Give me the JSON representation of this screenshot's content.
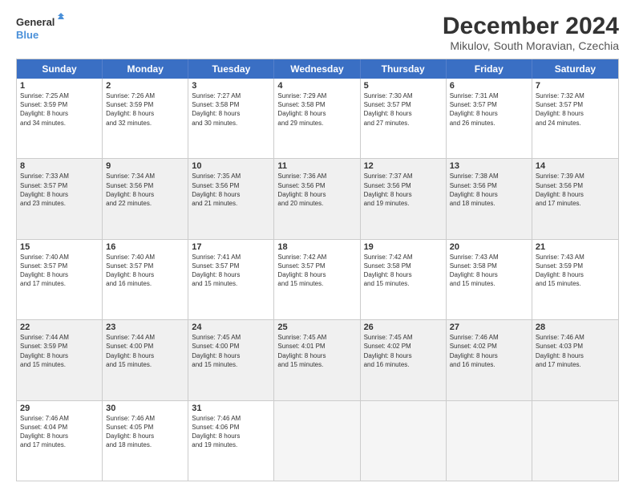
{
  "logo": {
    "line1": "General",
    "line2": "Blue"
  },
  "title": "December 2024",
  "subtitle": "Mikulov, South Moravian, Czechia",
  "days": [
    "Sunday",
    "Monday",
    "Tuesday",
    "Wednesday",
    "Thursday",
    "Friday",
    "Saturday"
  ],
  "rows": [
    [
      {
        "day": "1",
        "lines": [
          "Sunrise: 7:25 AM",
          "Sunset: 3:59 PM",
          "Daylight: 8 hours",
          "and 34 minutes."
        ],
        "shade": false
      },
      {
        "day": "2",
        "lines": [
          "Sunrise: 7:26 AM",
          "Sunset: 3:59 PM",
          "Daylight: 8 hours",
          "and 32 minutes."
        ],
        "shade": false
      },
      {
        "day": "3",
        "lines": [
          "Sunrise: 7:27 AM",
          "Sunset: 3:58 PM",
          "Daylight: 8 hours",
          "and 30 minutes."
        ],
        "shade": false
      },
      {
        "day": "4",
        "lines": [
          "Sunrise: 7:29 AM",
          "Sunset: 3:58 PM",
          "Daylight: 8 hours",
          "and 29 minutes."
        ],
        "shade": false
      },
      {
        "day": "5",
        "lines": [
          "Sunrise: 7:30 AM",
          "Sunset: 3:57 PM",
          "Daylight: 8 hours",
          "and 27 minutes."
        ],
        "shade": false
      },
      {
        "day": "6",
        "lines": [
          "Sunrise: 7:31 AM",
          "Sunset: 3:57 PM",
          "Daylight: 8 hours",
          "and 26 minutes."
        ],
        "shade": false
      },
      {
        "day": "7",
        "lines": [
          "Sunrise: 7:32 AM",
          "Sunset: 3:57 PM",
          "Daylight: 8 hours",
          "and 24 minutes."
        ],
        "shade": false
      }
    ],
    [
      {
        "day": "8",
        "lines": [
          "Sunrise: 7:33 AM",
          "Sunset: 3:57 PM",
          "Daylight: 8 hours",
          "and 23 minutes."
        ],
        "shade": true
      },
      {
        "day": "9",
        "lines": [
          "Sunrise: 7:34 AM",
          "Sunset: 3:56 PM",
          "Daylight: 8 hours",
          "and 22 minutes."
        ],
        "shade": true
      },
      {
        "day": "10",
        "lines": [
          "Sunrise: 7:35 AM",
          "Sunset: 3:56 PM",
          "Daylight: 8 hours",
          "and 21 minutes."
        ],
        "shade": true
      },
      {
        "day": "11",
        "lines": [
          "Sunrise: 7:36 AM",
          "Sunset: 3:56 PM",
          "Daylight: 8 hours",
          "and 20 minutes."
        ],
        "shade": true
      },
      {
        "day": "12",
        "lines": [
          "Sunrise: 7:37 AM",
          "Sunset: 3:56 PM",
          "Daylight: 8 hours",
          "and 19 minutes."
        ],
        "shade": true
      },
      {
        "day": "13",
        "lines": [
          "Sunrise: 7:38 AM",
          "Sunset: 3:56 PM",
          "Daylight: 8 hours",
          "and 18 minutes."
        ],
        "shade": true
      },
      {
        "day": "14",
        "lines": [
          "Sunrise: 7:39 AM",
          "Sunset: 3:56 PM",
          "Daylight: 8 hours",
          "and 17 minutes."
        ],
        "shade": true
      }
    ],
    [
      {
        "day": "15",
        "lines": [
          "Sunrise: 7:40 AM",
          "Sunset: 3:57 PM",
          "Daylight: 8 hours",
          "and 17 minutes."
        ],
        "shade": false
      },
      {
        "day": "16",
        "lines": [
          "Sunrise: 7:40 AM",
          "Sunset: 3:57 PM",
          "Daylight: 8 hours",
          "and 16 minutes."
        ],
        "shade": false
      },
      {
        "day": "17",
        "lines": [
          "Sunrise: 7:41 AM",
          "Sunset: 3:57 PM",
          "Daylight: 8 hours",
          "and 15 minutes."
        ],
        "shade": false
      },
      {
        "day": "18",
        "lines": [
          "Sunrise: 7:42 AM",
          "Sunset: 3:57 PM",
          "Daylight: 8 hours",
          "and 15 minutes."
        ],
        "shade": false
      },
      {
        "day": "19",
        "lines": [
          "Sunrise: 7:42 AM",
          "Sunset: 3:58 PM",
          "Daylight: 8 hours",
          "and 15 minutes."
        ],
        "shade": false
      },
      {
        "day": "20",
        "lines": [
          "Sunrise: 7:43 AM",
          "Sunset: 3:58 PM",
          "Daylight: 8 hours",
          "and 15 minutes."
        ],
        "shade": false
      },
      {
        "day": "21",
        "lines": [
          "Sunrise: 7:43 AM",
          "Sunset: 3:59 PM",
          "Daylight: 8 hours",
          "and 15 minutes."
        ],
        "shade": false
      }
    ],
    [
      {
        "day": "22",
        "lines": [
          "Sunrise: 7:44 AM",
          "Sunset: 3:59 PM",
          "Daylight: 8 hours",
          "and 15 minutes."
        ],
        "shade": true
      },
      {
        "day": "23",
        "lines": [
          "Sunrise: 7:44 AM",
          "Sunset: 4:00 PM",
          "Daylight: 8 hours",
          "and 15 minutes."
        ],
        "shade": true
      },
      {
        "day": "24",
        "lines": [
          "Sunrise: 7:45 AM",
          "Sunset: 4:00 PM",
          "Daylight: 8 hours",
          "and 15 minutes."
        ],
        "shade": true
      },
      {
        "day": "25",
        "lines": [
          "Sunrise: 7:45 AM",
          "Sunset: 4:01 PM",
          "Daylight: 8 hours",
          "and 15 minutes."
        ],
        "shade": true
      },
      {
        "day": "26",
        "lines": [
          "Sunrise: 7:45 AM",
          "Sunset: 4:02 PM",
          "Daylight: 8 hours",
          "and 16 minutes."
        ],
        "shade": true
      },
      {
        "day": "27",
        "lines": [
          "Sunrise: 7:46 AM",
          "Sunset: 4:02 PM",
          "Daylight: 8 hours",
          "and 16 minutes."
        ],
        "shade": true
      },
      {
        "day": "28",
        "lines": [
          "Sunrise: 7:46 AM",
          "Sunset: 4:03 PM",
          "Daylight: 8 hours",
          "and 17 minutes."
        ],
        "shade": true
      }
    ],
    [
      {
        "day": "29",
        "lines": [
          "Sunrise: 7:46 AM",
          "Sunset: 4:04 PM",
          "Daylight: 8 hours",
          "and 17 minutes."
        ],
        "shade": false
      },
      {
        "day": "30",
        "lines": [
          "Sunrise: 7:46 AM",
          "Sunset: 4:05 PM",
          "Daylight: 8 hours",
          "and 18 minutes."
        ],
        "shade": false
      },
      {
        "day": "31",
        "lines": [
          "Sunrise: 7:46 AM",
          "Sunset: 4:06 PM",
          "Daylight: 8 hours",
          "and 19 minutes."
        ],
        "shade": false
      },
      {
        "day": "",
        "lines": [],
        "shade": false,
        "empty": true
      },
      {
        "day": "",
        "lines": [],
        "shade": false,
        "empty": true
      },
      {
        "day": "",
        "lines": [],
        "shade": false,
        "empty": true
      },
      {
        "day": "",
        "lines": [],
        "shade": false,
        "empty": true
      }
    ]
  ]
}
